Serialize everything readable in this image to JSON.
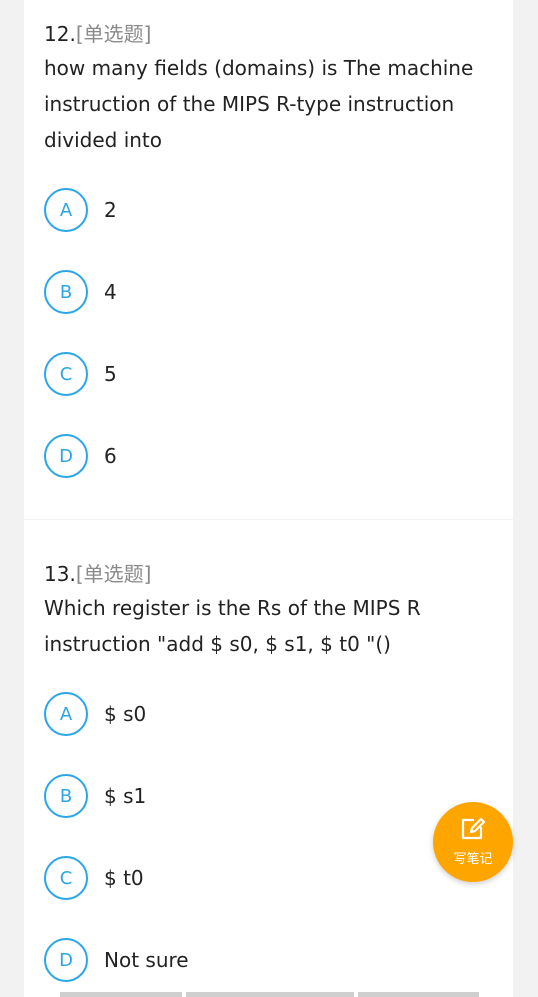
{
  "questions": [
    {
      "number": "12.",
      "type": "[单选题]",
      "text": "how many fields (domains) is The machine instruction of the MIPS R-type instruction divided into",
      "options": [
        {
          "letter": "A",
          "text": "2"
        },
        {
          "letter": "B",
          "text": "4"
        },
        {
          "letter": "C",
          "text": "5"
        },
        {
          "letter": "D",
          "text": "6"
        }
      ]
    },
    {
      "number": "13.",
      "type": "[单选题]",
      "text": "Which register is the  Rs of the MIPS R instruction \"add $ s0, $ s1, $ t0 \"()",
      "options": [
        {
          "letter": "A",
          "text": "$ s0"
        },
        {
          "letter": "B",
          "text": "$ s1"
        },
        {
          "letter": "C",
          "text": "$ t0"
        },
        {
          "letter": "D",
          "text": "Not sure"
        }
      ]
    }
  ],
  "fab": {
    "label": "写笔记",
    "icon": "edit-note-icon"
  },
  "colors": {
    "accent": "#2aa6e8",
    "fab": "#ffa500",
    "background": "#f2f2f2"
  }
}
